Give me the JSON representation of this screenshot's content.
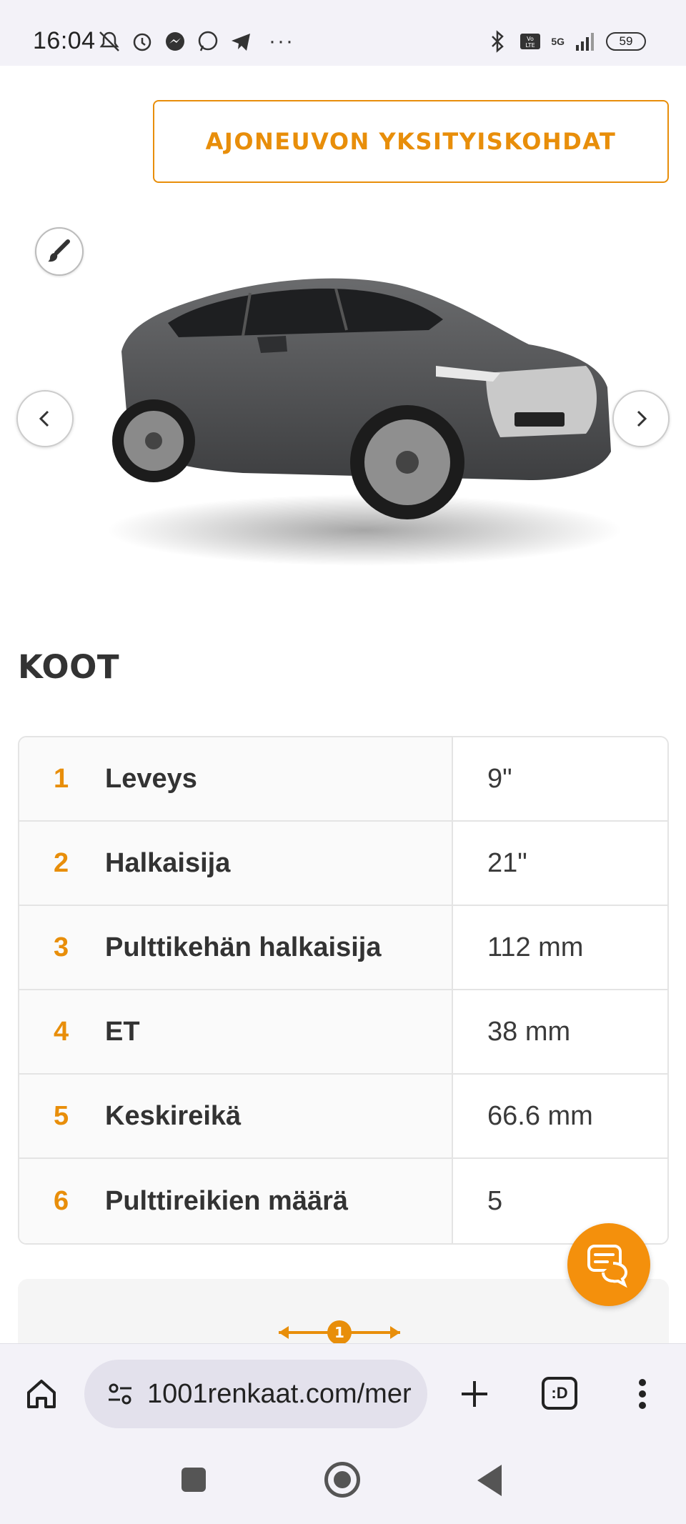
{
  "status_bar": {
    "time": "16:04",
    "network": "5G",
    "battery": "59"
  },
  "header": {
    "vehicle_details_label": "AJONEUVON YKSITYISKOHDAT"
  },
  "sizes": {
    "title": "KOOT",
    "rows": [
      {
        "num": "1",
        "label": "Leveys",
        "value": "9\""
      },
      {
        "num": "2",
        "label": "Halkaisija",
        "value": "21\""
      },
      {
        "num": "3",
        "label": "Pulttikehän halkaisija",
        "value": "112 mm"
      },
      {
        "num": "4",
        "label": "ET",
        "value": "38 mm"
      },
      {
        "num": "5",
        "label": "Keskireikä",
        "value": "66.6 mm"
      },
      {
        "num": "6",
        "label": "Pulttireikien määrä",
        "value": "5"
      }
    ]
  },
  "browser": {
    "url": "1001renkaat.com/mer",
    "tabs_label": ":D"
  },
  "colors": {
    "accent": "#e88e0a",
    "fab": "#f4900c"
  }
}
